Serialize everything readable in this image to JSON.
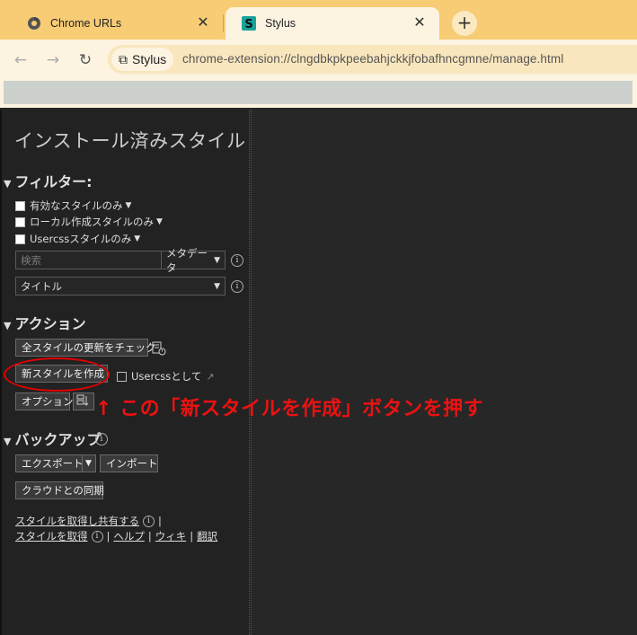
{
  "browser": {
    "tabs": [
      {
        "title": "Chrome URLs",
        "icon": "chrome-icon",
        "active": false
      },
      {
        "title": "Stylus",
        "icon": "stylus-icon",
        "active": true
      }
    ],
    "site_chip": "Stylus",
    "url": "chrome-extension://clngdbkpkpeebahjckkjfobafhncgmne/manage.html",
    "colors": {
      "tabbar": "#f7cc74",
      "toolbar": "#fcf3e1"
    }
  },
  "manager": {
    "title": "インストール済みスタイル",
    "filter": {
      "heading": "フィルター:",
      "checkboxes": [
        "有効なスタイルのみ",
        "ローカル作成スタイルのみ",
        "Usercssスタイルのみ"
      ],
      "search_placeholder": "検索",
      "search_scope": "メタデータ",
      "sort": "タイトル"
    },
    "actions": {
      "heading": "アクション",
      "check_updates": "全スタイルの更新をチェック",
      "write_new": "新スタイルを作成",
      "as_usercss": "Usercssとして",
      "options": "オプション"
    },
    "backup": {
      "heading": "バックアップ",
      "export": "エクスポート",
      "import": "インポート",
      "sync": "クラウドとの同期"
    },
    "links": {
      "get_and_share": "スタイルを取得し共有する",
      "get": "スタイルを取得",
      "help": "ヘルプ",
      "wiki": "ウィキ",
      "translate": "翻訳",
      "separator": "|"
    }
  },
  "annotation": {
    "text": "↑ この「新スタイルを作成」ボタンを押す",
    "color": "#ee1111"
  }
}
